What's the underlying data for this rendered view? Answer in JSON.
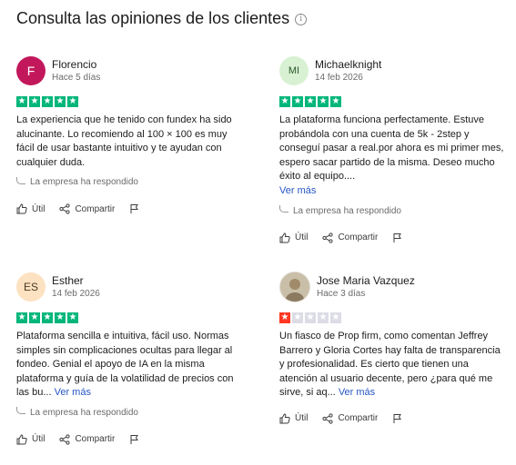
{
  "page_title": "Consulta las opiniones de los clientes",
  "info_glyph": "i",
  "reply_text": "La empresa ha respondido",
  "actions": {
    "useful": "Útil",
    "share": "Compartir"
  },
  "reviews": [
    {
      "initials": "F",
      "name": "Florencio",
      "date": "Hace 5 días",
      "rating": 5,
      "text": "La experiencia que he tenido con fundex ha sido alucinante. Lo recomiendo al 100 × 100 es muy fácil de usar bastante intuitivo y te ayudan con cualquier duda.",
      "more": ""
    },
    {
      "initials": "MI",
      "name": "Michaelknight",
      "date": "14 feb 2026",
      "rating": 5,
      "text": "La plataforma funciona perfectamente. Estuve probándola con una cuenta de 5k - 2step y conseguí pasar a real.por ahora es mi primer mes, espero sacar partido de la misma. Deseo mucho éxito al equipo....",
      "more": "Ver más"
    },
    {
      "initials": "ES",
      "name": "Esther",
      "date": "14 feb 2026",
      "rating": 5,
      "text": "Plataforma sencilla e intuitiva, fácil uso. Normas simples sin complicaciones ocultas para llegar al fondeo. Genial el apoyo de IA en la misma plataforma y guía de la volatilidad de precios con las bu...",
      "more": "Ver más"
    },
    {
      "initials": "",
      "name": "Jose Maria Vazquez",
      "date": "Hace 3 días",
      "rating": 1,
      "text": "Un fiasco de Prop firm, como comentan Jeffrey Barrero y Gloria Cortes hay falta de transparencia y profesionalidad. Es cierto que tienen una atención al usuario decente, pero ¿para qué me sirve, si aq...",
      "more": "Ver más"
    }
  ],
  "colors": {
    "star_green": "#00b67a",
    "star_red": "#ff3722",
    "star_empty": "#dcdce6",
    "link": "#2756c5"
  }
}
